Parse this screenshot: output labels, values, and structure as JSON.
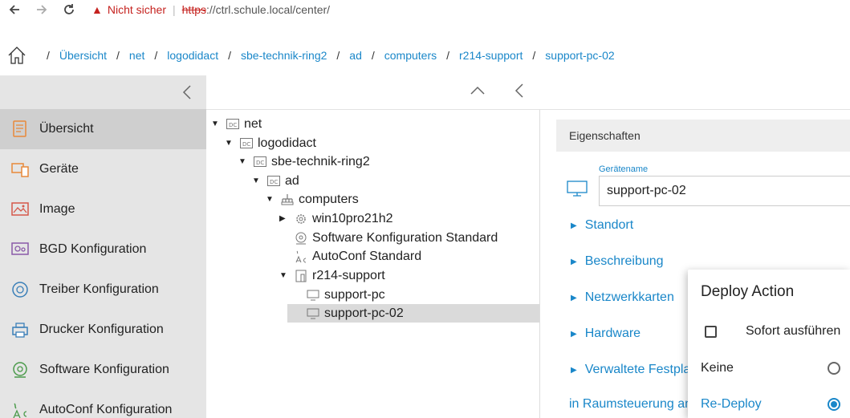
{
  "browser": {
    "security_label": "Nicht sicher",
    "protocol": "https",
    "url_rest": "://ctrl.schule.local/center/"
  },
  "breadcrumb": {
    "items": [
      "Übersicht",
      "net",
      "logodidact",
      "sbe-technik-ring2",
      "ad",
      "computers",
      "r214-support",
      "support-pc-02"
    ],
    "separator": "/"
  },
  "sidebar": {
    "items": [
      {
        "label": "Übersicht",
        "icon": "overview-icon",
        "active": true
      },
      {
        "label": "Geräte",
        "icon": "devices-icon"
      },
      {
        "label": "Image",
        "icon": "image-icon"
      },
      {
        "label": "BGD Konfiguration",
        "icon": "bgd-config-icon"
      },
      {
        "label": "Treiber Konfiguration",
        "icon": "driver-config-icon"
      },
      {
        "label": "Drucker Konfiguration",
        "icon": "printer-config-icon"
      },
      {
        "label": "Software Konfiguration",
        "icon": "software-config-icon"
      },
      {
        "label": "AutoConf Konfiguration",
        "icon": "autoconf-config-icon"
      }
    ]
  },
  "tree": {
    "nodes": [
      {
        "label": "net",
        "icon": "dc-icon",
        "expanded": true
      },
      {
        "label": "logodidact",
        "icon": "dc-icon",
        "expanded": true
      },
      {
        "label": "sbe-technik-ring2",
        "icon": "dc-icon",
        "expanded": true
      },
      {
        "label": "ad",
        "icon": "dc-icon",
        "expanded": true
      },
      {
        "label": "computers",
        "icon": "network-icon",
        "expanded": true
      },
      {
        "label": "win10pro21h2",
        "icon": "gear-icon",
        "expanded": false
      },
      {
        "label": "Software Konfiguration Standard",
        "icon": "software-icon"
      },
      {
        "label": "AutoConf Standard",
        "icon": "autoconf-icon"
      },
      {
        "label": "r214-support",
        "icon": "room-icon",
        "expanded": true
      },
      {
        "label": "support-pc",
        "icon": "monitor-icon"
      },
      {
        "label": "support-pc-02",
        "icon": "monitor-icon",
        "selected": true
      }
    ]
  },
  "properties": {
    "header": "Eigenschaften",
    "device_name_label": "Gerätename",
    "device_name_value": "support-pc-02",
    "sections": [
      "Standort",
      "Beschreibung",
      "Netzwerkkarten",
      "Hardware",
      "Verwaltete Festpla"
    ],
    "room_control_link": "in Raumsteuerung an"
  },
  "deploy_popup": {
    "title": "Deploy Action",
    "immediate_label": "Sofort ausführen",
    "immediate_checked": false,
    "options": [
      {
        "label": "Keine",
        "selected": false
      },
      {
        "label": "Re-Deploy",
        "selected": true
      }
    ]
  },
  "colors": {
    "accent": "#1a87c9",
    "warning": "#c5221f",
    "sidebar_bg": "#e5e5e5",
    "sidebar_active": "#cfcfcf",
    "selected_row": "#dadada"
  }
}
